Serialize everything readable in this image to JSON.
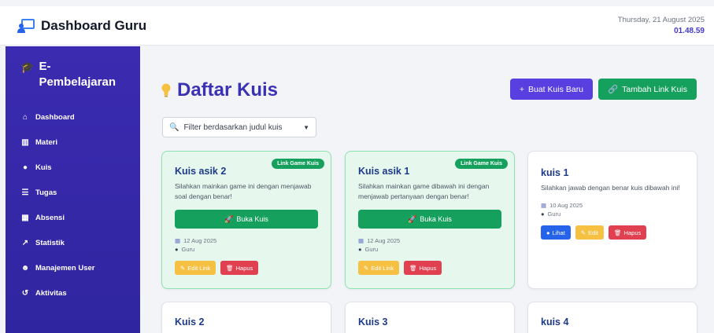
{
  "header": {
    "title": "Dashboard Guru",
    "date": "Thursday, 21 August 2025",
    "time": "01.48.59"
  },
  "sidebar": {
    "title": "E-Pembelajaran",
    "items": [
      {
        "label": "Dashboard",
        "icon": "home-icon"
      },
      {
        "label": "Materi",
        "icon": "book-icon"
      },
      {
        "label": "Kuis",
        "icon": "lightbulb-icon"
      },
      {
        "label": "Tugas",
        "icon": "list-icon"
      },
      {
        "label": "Absensi",
        "icon": "calendar-check-icon"
      },
      {
        "label": "Statistik",
        "icon": "chart-line-icon"
      },
      {
        "label": "Manajemen User",
        "icon": "users-icon"
      },
      {
        "label": "Aktivitas",
        "icon": "history-icon"
      }
    ]
  },
  "main": {
    "title": "Daftar Kuis",
    "new_quiz_label": "Buat Kuis Baru",
    "add_link_label": "Tambah Link Kuis",
    "filter_label": "Filter berdasarkan judul kuis"
  },
  "cards": [
    {
      "title": "Kuis asik 2",
      "badge": "Link Game Kuis",
      "desc": "Silahkan mainkan game ini dengan menjawab soal dengan benar!",
      "open_label": "Buka Kuis",
      "date": "12 Aug 2025",
      "author": "Guru",
      "edit_label": "Edit Link",
      "delete_label": "Hapus"
    },
    {
      "title": "Kuis asik 1",
      "badge": "Link Game Kuis",
      "desc": "Silahkan mainkan game dibawah ini dengan menjawab pertanyaan dengan benar!",
      "open_label": "Buka Kuis",
      "date": "12 Aug 2025",
      "author": "Guru",
      "edit_label": "Edit Link",
      "delete_label": "Hapus"
    },
    {
      "title": "kuis 1",
      "desc": "Silahkan jawab dengan benar kuis dibawah ini!",
      "date": "10 Aug 2025",
      "author": "Guru",
      "view_label": "Lihat",
      "edit_label": "Edit",
      "delete_label": "Hapus"
    },
    {
      "title": "Kuis 2"
    },
    {
      "title": "Kuis 3"
    },
    {
      "title": "kuis 4"
    }
  ],
  "colors": {
    "sidebar": "#3b2bb0",
    "accent": "#3b32b3",
    "green": "#16a05d",
    "purple": "#5a3fe0",
    "yellow": "#f6c042",
    "red": "#e14050",
    "blue": "#2563eb"
  }
}
